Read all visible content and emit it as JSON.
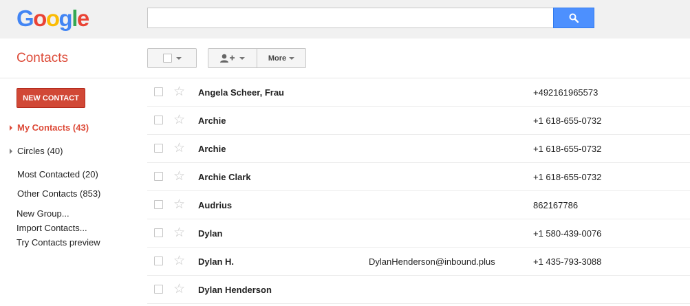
{
  "header": {
    "logo_letters": [
      {
        "char": "G",
        "color": "#4285f4"
      },
      {
        "char": "o",
        "color": "#ea4335"
      },
      {
        "char": "o",
        "color": "#fbbc05"
      },
      {
        "char": "g",
        "color": "#4285f4"
      },
      {
        "char": "l",
        "color": "#34a853"
      },
      {
        "char": "e",
        "color": "#ea4335"
      }
    ],
    "search": {
      "value": "",
      "placeholder": ""
    },
    "search_button_icon": "search-icon"
  },
  "toolbar": {
    "app_title": "Contacts",
    "select_icon": "checkbox-icon",
    "add_person_icon": "add-person-icon",
    "more_label": "More"
  },
  "sidebar": {
    "new_contact_label": "NEW CONTACT",
    "nav": [
      {
        "label": "My Contacts (43)",
        "active": true,
        "expandable": true
      },
      {
        "label": "Circles (40)",
        "active": false,
        "expandable": true
      },
      {
        "label": "Most Contacted (20)",
        "active": false,
        "expandable": false
      },
      {
        "label": "Other Contacts (853)",
        "active": false,
        "expandable": false
      }
    ],
    "links": [
      "New Group...",
      "Import Contacts...",
      "Try Contacts preview"
    ]
  },
  "contacts": [
    {
      "name": "Angela Scheer, Frau",
      "email": "",
      "phone": "+492161965573"
    },
    {
      "name": "Archie",
      "email": "",
      "phone": "+1 618-655-0732"
    },
    {
      "name": "Archie",
      "email": "",
      "phone": "+1 618-655-0732"
    },
    {
      "name": "Archie Clark",
      "email": "",
      "phone": "+1 618-655-0732"
    },
    {
      "name": "Audrius",
      "email": "",
      "phone": "862167786"
    },
    {
      "name": "Dylan",
      "email": "",
      "phone": "+1 580-439-0076"
    },
    {
      "name": "Dylan H.",
      "email": "DylanHenderson@inbound.plus",
      "phone": "+1 435-793-3088"
    },
    {
      "name": "Dylan Henderson",
      "email": "",
      "phone": ""
    }
  ],
  "colors": {
    "accent_red": "#dd4b39",
    "new_contact_bg": "#d14836",
    "search_blue": "#4d90fe"
  }
}
